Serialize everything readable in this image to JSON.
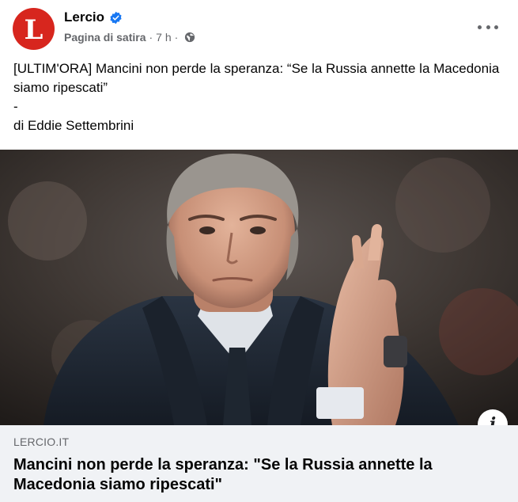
{
  "post": {
    "avatar": {
      "letter": "L",
      "color": "#d7261e"
    },
    "page_name": "Lercio",
    "verified_icon": "verified-badge-icon",
    "category": "Pagina di satira",
    "time": "7 h",
    "separator": "·",
    "privacy_icon": "globe-icon",
    "more_icon": "more-options-icon",
    "text_lines": [
      "[ULTIM'ORA] Mancini non perde la speranza: “Se la Russia annette la Macedonia siamo ripescati”",
      "-",
      "di Eddie Settembrini"
    ]
  },
  "link_preview": {
    "image_alt": "Man in dark coat clapping",
    "info_icon": "info-icon",
    "info_glyph": "i",
    "domain": "LERCIO.IT",
    "title": "Mancini non perde la speranza: \"Se la Russia annette la Macedonia siamo ripescati\""
  },
  "colors": {
    "accent": "#1877f2",
    "card_bg": "#f0f2f5",
    "secondary_text": "#65676b"
  }
}
